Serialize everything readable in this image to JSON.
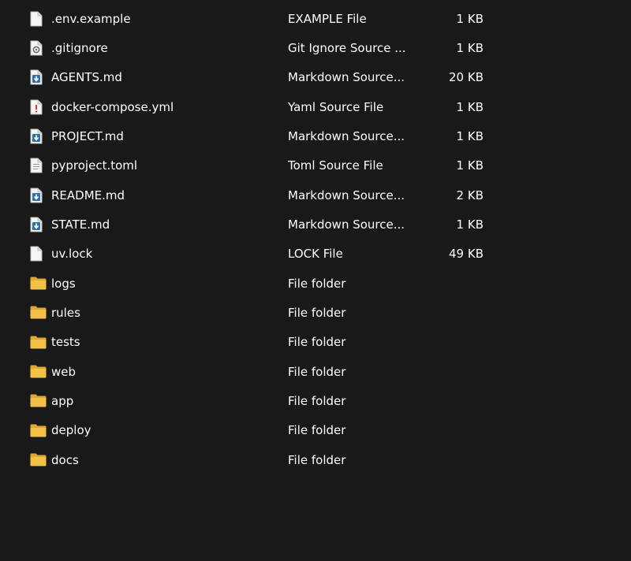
{
  "files": [
    {
      "name": ".env.example",
      "type": "EXAMPLE File",
      "size": "1 KB",
      "icon": "blank"
    },
    {
      "name": ".gitignore",
      "type": "Git Ignore Source ...",
      "size": "1 KB",
      "icon": "gear"
    },
    {
      "name": "AGENTS.md",
      "type": "Markdown Source...",
      "size": "20 KB",
      "icon": "markdown"
    },
    {
      "name": "docker-compose.yml",
      "type": "Yaml Source File",
      "size": "1 KB",
      "icon": "yaml"
    },
    {
      "name": "PROJECT.md",
      "type": "Markdown Source...",
      "size": "1 KB",
      "icon": "markdown"
    },
    {
      "name": "pyproject.toml",
      "type": "Toml Source File",
      "size": "1 KB",
      "icon": "text"
    },
    {
      "name": "README.md",
      "type": "Markdown Source...",
      "size": "2 KB",
      "icon": "markdown"
    },
    {
      "name": "STATE.md",
      "type": "Markdown Source...",
      "size": "1 KB",
      "icon": "markdown"
    },
    {
      "name": "uv.lock",
      "type": "LOCK File",
      "size": "49 KB",
      "icon": "blank"
    },
    {
      "name": "logs",
      "type": "File folder",
      "size": "",
      "icon": "folder"
    },
    {
      "name": "rules",
      "type": "File folder",
      "size": "",
      "icon": "folder"
    },
    {
      "name": "tests",
      "type": "File folder",
      "size": "",
      "icon": "folder"
    },
    {
      "name": "web",
      "type": "File folder",
      "size": "",
      "icon": "folder"
    },
    {
      "name": "app",
      "type": "File folder",
      "size": "",
      "icon": "folder"
    },
    {
      "name": "deploy",
      "type": "File folder",
      "size": "",
      "icon": "folder"
    },
    {
      "name": "docs",
      "type": "File folder",
      "size": "",
      "icon": "folder"
    }
  ],
  "colors": {
    "background": "#191919",
    "text": "#ffffff",
    "folder": "#f3c14a",
    "markdown_badge": "#2f6fa8"
  }
}
